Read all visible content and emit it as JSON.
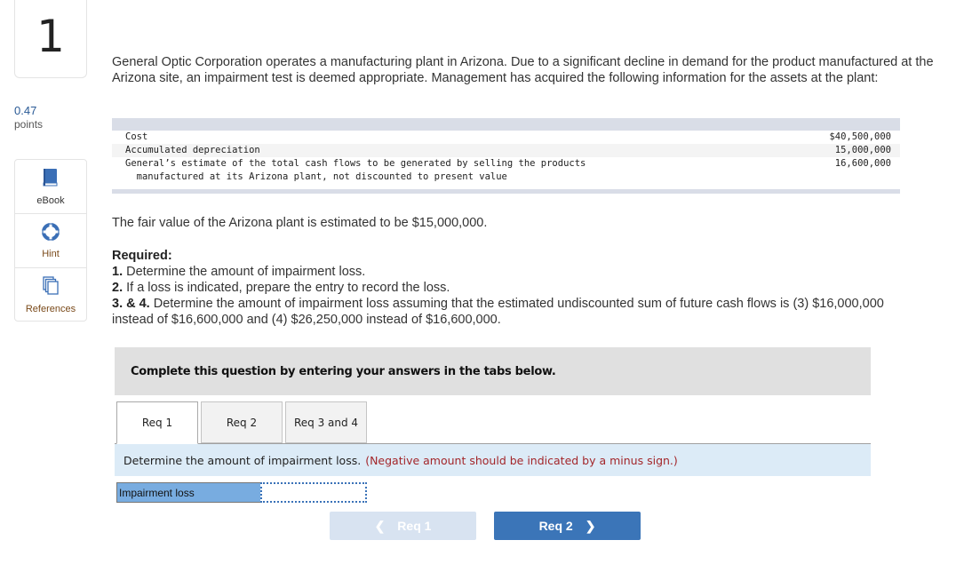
{
  "question": {
    "number": "1",
    "points_value": "0.47",
    "points_label": "points"
  },
  "tools": [
    {
      "label": "eBook",
      "icon": "book-icon"
    },
    {
      "label": "Hint",
      "icon": "lifebuoy-icon"
    },
    {
      "label": "References",
      "icon": "documents-icon"
    }
  ],
  "intro": "General Optic Corporation operates a manufacturing plant in Arizona. Due to a significant decline in demand for the product manufactured at the Arizona site, an impairment test is deemed appropriate. Management has acquired the following information for the assets at the plant:",
  "data_table": {
    "rows": [
      {
        "label": "Cost",
        "value": "$40,500,000"
      },
      {
        "label": "Accumulated depreciation",
        "value": "15,000,000"
      },
      {
        "label": "General’s estimate of the total cash flows to be generated by selling the products",
        "value": "16,600,000"
      },
      {
        "label": "  manufactured at its Arizona plant, not discounted to present value",
        "value": ""
      }
    ]
  },
  "fair_value_text": "The fair value of the Arizona plant is estimated to be $15,000,000.",
  "required": {
    "heading": "Required:",
    "items": [
      {
        "num": "1.",
        "text": " Determine the amount of impairment loss."
      },
      {
        "num": "2.",
        "text": " If a loss is indicated, prepare the entry to record the loss."
      },
      {
        "num": "3. & 4.",
        "text": " Determine the amount of impairment loss assuming that the estimated undiscounted sum of future cash flows is (3) $16,000,000 instead of $16,600,000 and (4) $26,250,000 instead of $16,600,000."
      }
    ]
  },
  "instruction": "Complete this question by entering your answers in the tabs below.",
  "tabs": [
    {
      "label": "Req 1",
      "active": true
    },
    {
      "label": "Req 2",
      "active": false
    },
    {
      "label": "Req 3 and 4",
      "active": false
    }
  ],
  "panel": {
    "instruction": "Determine the amount of impairment loss.",
    "note": "(Negative amount should be indicated by a minus sign.)",
    "answer_label": "Impairment loss",
    "answer_value": ""
  },
  "nav": {
    "prev_label": "Req 1",
    "next_label": "Req 2"
  },
  "colors": {
    "accent": "#3b75b8",
    "note_red": "#a3262a",
    "panel_bg": "#dcebf7",
    "answer_label_bg": "#78ace0"
  }
}
